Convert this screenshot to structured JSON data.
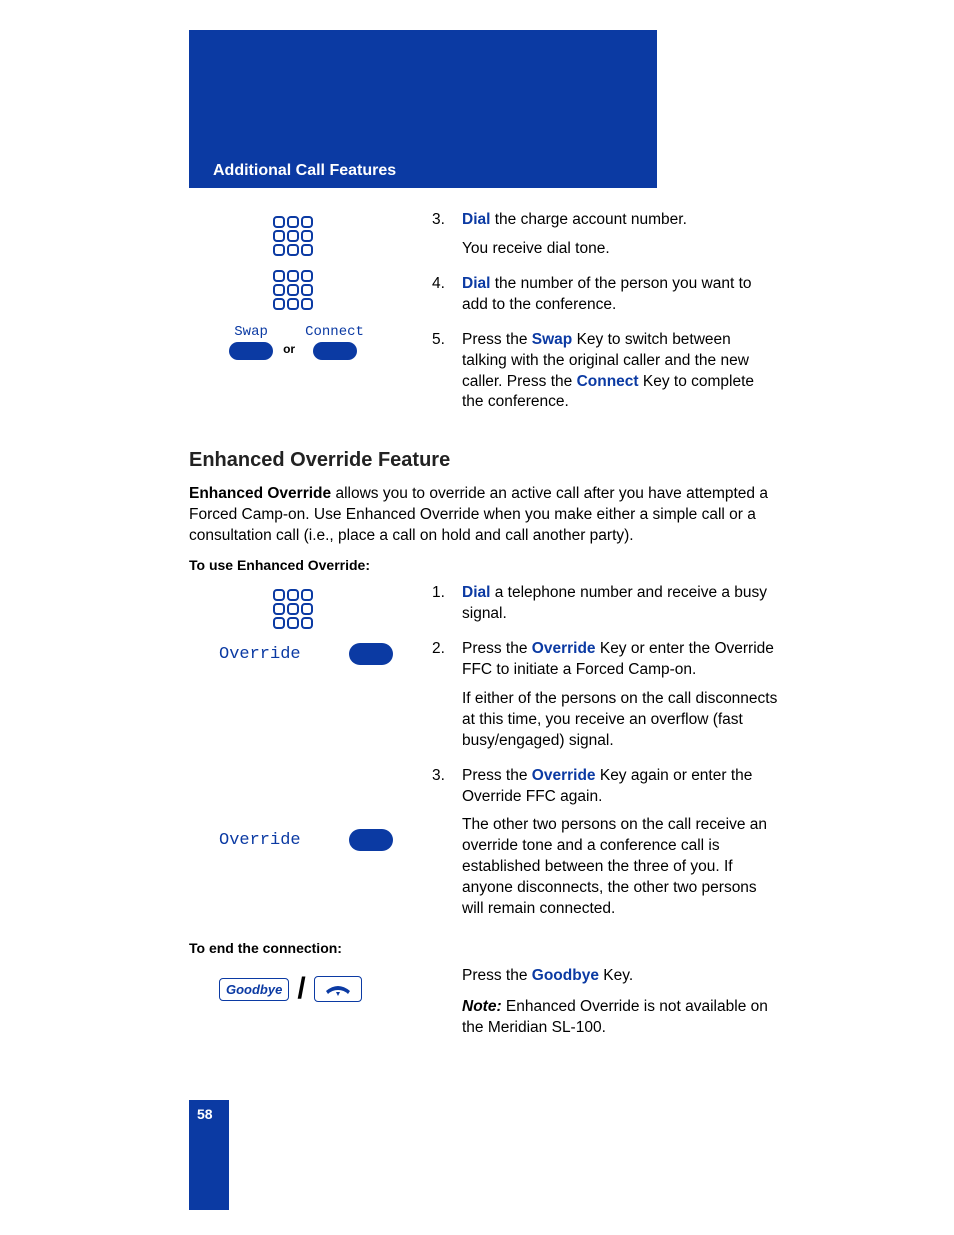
{
  "header": {
    "title": "Additional Call Features"
  },
  "top_section": {
    "softkeys": {
      "swap": "Swap",
      "connect": "Connect",
      "or": "or"
    },
    "steps": [
      {
        "kw": "Dial",
        "text_after": " the charge account number.",
        "sub": "You receive dial tone."
      },
      {
        "kw": "Dial",
        "text_after": " the number of the person you want to add to the conference."
      },
      {
        "text_before": "Press the ",
        "kw": "Swap",
        "text_after": " Key to switch between talking with the original caller and the new caller. Press the ",
        "kw2": "Connect",
        "text_after2": " Key to complete the conference."
      }
    ]
  },
  "section2": {
    "heading": "Enhanced Override Feature",
    "intro_bold": "Enhanced Override",
    "intro_rest": " allows you to override an active call after you have attempted a Forced Camp-on. Use Enhanced Override when you make either a simple call or a consultation call (i.e., place a call on hold and call another party).",
    "sub1": "To use Enhanced Override:",
    "override_label": "Override",
    "steps": [
      {
        "kw": "Dial",
        "text_after": " a telephone number and receive a busy signal."
      },
      {
        "text_before": "Press the ",
        "kw": "Override",
        "text_after": " Key or enter the Override FFC to initiate a Forced Camp-on.",
        "sub": "If either of the persons on the call disconnects at this time, you receive an overflow (fast busy/engaged) signal."
      },
      {
        "text_before": "Press the ",
        "kw": "Override",
        "text_after": " Key again or enter the Override FFC again.",
        "sub": "The other two persons on the call receive an override tone and a conference call is established between the three of you. If anyone disconnects, the other two persons will remain connected."
      }
    ],
    "sub2": "To end the connection:",
    "goodbye_label": "Goodbye",
    "goodbye_text_before": "Press the ",
    "goodbye_kw": "Goodbye",
    "goodbye_text_after": " Key.",
    "note_label": "Note:",
    "note_text": " Enhanced Override is not available on the Meridian SL-100."
  },
  "page_number": "58"
}
